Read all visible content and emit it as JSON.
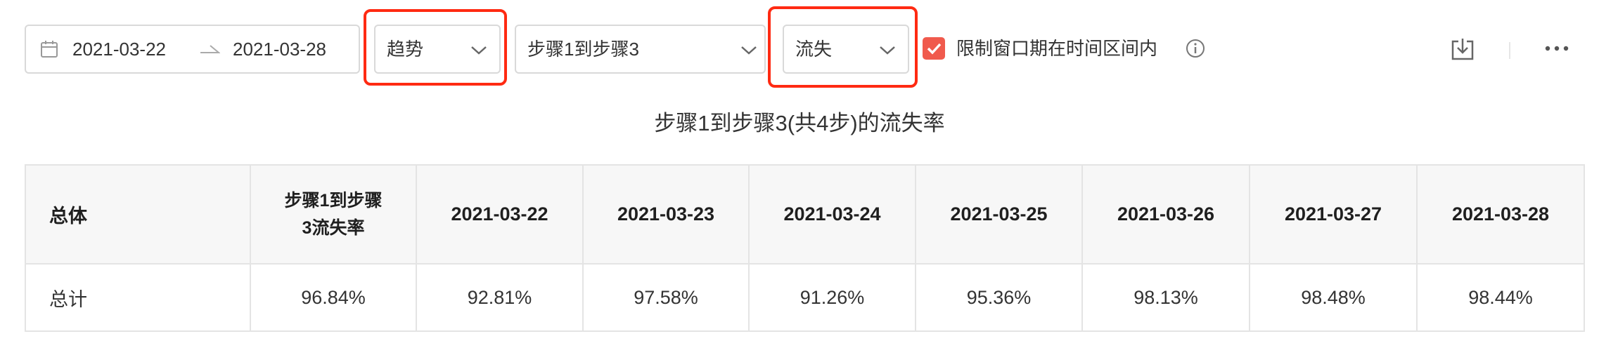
{
  "toolbar": {
    "date_range": {
      "start": "2021-03-22",
      "end": "2021-03-28"
    },
    "display_mode": {
      "value": "趋势"
    },
    "step_range": {
      "value": "步骤1到步骤3"
    },
    "metric": {
      "value": "流失"
    },
    "window_limit": {
      "label": "限制窗口期在时间区间内",
      "checked": true
    }
  },
  "report": {
    "title": "步骤1到步骤3(共4步)的流失率"
  },
  "table": {
    "group_header": "总体",
    "metric_header_line1": "步骤1到步骤",
    "metric_header_line2": "3流失率",
    "date_headers": [
      "2021-03-22",
      "2021-03-23",
      "2021-03-24",
      "2021-03-25",
      "2021-03-26",
      "2021-03-27",
      "2021-03-28"
    ],
    "rows": [
      {
        "label": "总计",
        "overall": "96.84%",
        "values": [
          "92.81%",
          "97.58%",
          "91.26%",
          "95.36%",
          "98.13%",
          "98.48%",
          "98.44%"
        ]
      }
    ]
  },
  "colors": {
    "highlight": "#ff2a12",
    "checkbox": "#f05a4d",
    "border": "#d9d9d9",
    "header_bg": "#f7f7f7"
  },
  "icons": [
    "calendar-icon",
    "range-arrow-icon",
    "chevron-down-icon",
    "check-icon",
    "info-icon",
    "download-icon",
    "more-icon"
  ]
}
